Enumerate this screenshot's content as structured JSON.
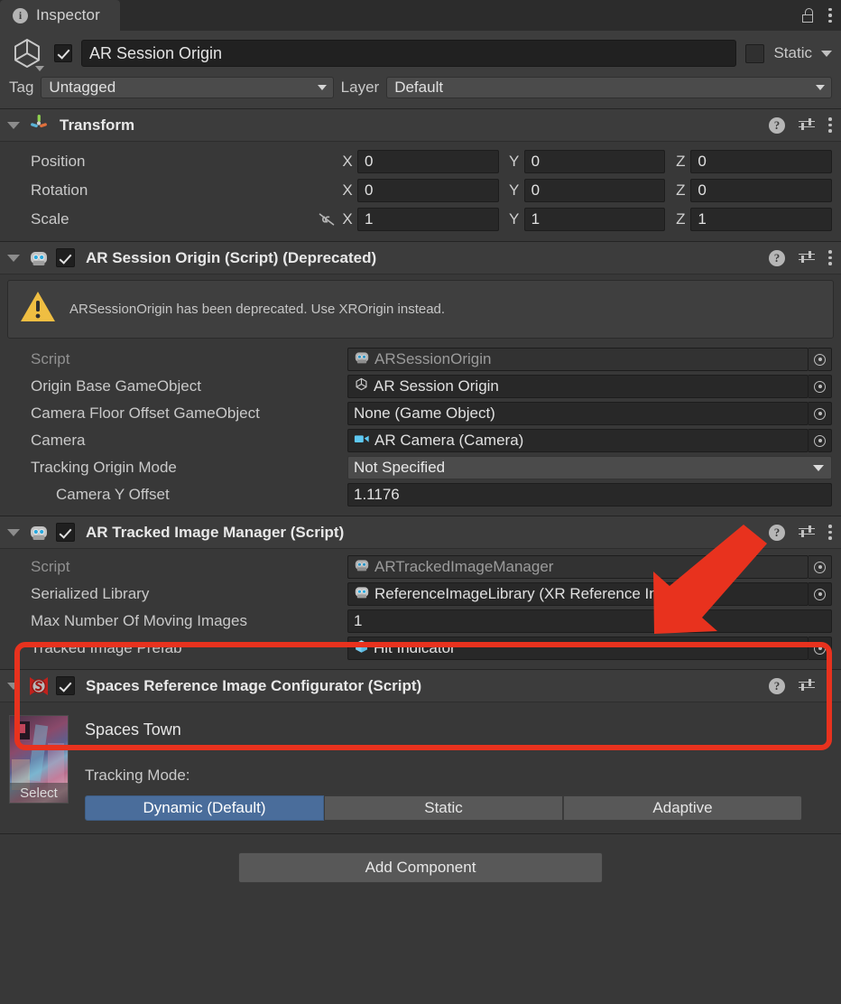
{
  "window": {
    "tab_label": "Inspector",
    "info_icon": "info-icon",
    "lock_icon": "unlocked-padlock-icon",
    "menu_icon": "kebab-menu-icon"
  },
  "gameobject": {
    "icon": "gameobject-cube-icon",
    "enabled": true,
    "name": "AR Session Origin",
    "static_label": "Static",
    "static_checked": false,
    "tag_label": "Tag",
    "tag_value": "Untagged",
    "layer_label": "Layer",
    "layer_value": "Default"
  },
  "components": [
    {
      "id": "transform",
      "icon": "transform-axis-icon",
      "title": "Transform",
      "has_checkbox": false,
      "rows": [
        {
          "label": "Position",
          "x": "0",
          "y": "0",
          "z": "0",
          "link": false
        },
        {
          "label": "Rotation",
          "x": "0",
          "y": "0",
          "z": "0",
          "link": false
        },
        {
          "label": "Scale",
          "x": "1",
          "y": "1",
          "z": "1",
          "link": true
        }
      ],
      "axis_labels": {
        "x": "X",
        "y": "Y",
        "z": "Z"
      }
    },
    {
      "id": "ar-session-origin",
      "icon": "script-robot-icon",
      "title": "AR Session Origin (Script) (Deprecated)",
      "enabled": true,
      "warning": "ARSessionOrigin has been deprecated. Use XROrigin instead.",
      "warning_icon": "warning-triangle-icon",
      "fields": [
        {
          "label": "Script",
          "value": "ARSessionOrigin",
          "icon": "script-robot-icon",
          "kind": "object",
          "disabled": true
        },
        {
          "label": "Origin Base GameObject",
          "value": "AR Session Origin",
          "icon": "gameobject-cube-icon",
          "kind": "object",
          "disabled": false
        },
        {
          "label": "Camera Floor Offset GameObject",
          "value": "None (Game Object)",
          "icon": "",
          "kind": "object",
          "disabled": false
        },
        {
          "label": "Camera",
          "value": "AR Camera (Camera)",
          "icon": "camera-icon",
          "kind": "object",
          "disabled": false
        },
        {
          "label": "Tracking Origin Mode",
          "value": "Not Specified",
          "icon": "",
          "kind": "dropdown",
          "disabled": false
        },
        {
          "label": "Camera Y Offset",
          "value": "1.1176",
          "icon": "",
          "kind": "text",
          "disabled": false,
          "indent": true
        }
      ]
    },
    {
      "id": "ar-tracked-image-manager",
      "icon": "script-robot-icon",
      "title": "AR Tracked Image Manager (Script)",
      "enabled": true,
      "fields": [
        {
          "label": "Script",
          "value": "ARTrackedImageManager",
          "icon": "script-robot-icon",
          "kind": "object",
          "disabled": true
        },
        {
          "label": "Serialized Library",
          "value": "ReferenceImageLibrary (XR Reference Image Lib",
          "icon": "script-robot-icon",
          "kind": "object",
          "disabled": false
        },
        {
          "label": "Max Number Of Moving Images",
          "value": "1",
          "icon": "",
          "kind": "text",
          "disabled": false
        },
        {
          "label": "Tracked Image Prefab",
          "value": "Hit Indicator",
          "icon": "prefab-cube-icon",
          "kind": "object",
          "disabled": false
        }
      ]
    },
    {
      "id": "spaces-reference-image-configurator",
      "icon": "spaces-s-logo-icon",
      "title": "Spaces Reference Image Configurator (Script)",
      "enabled": true,
      "image_name": "Spaces Town",
      "thumbnail_select_label": "Select",
      "tracking_mode_label": "Tracking Mode:",
      "tracking_modes": [
        "Dynamic (Default)",
        "Static",
        "Adaptive"
      ],
      "tracking_mode_selected": 0
    }
  ],
  "footer": {
    "add_component_label": "Add Component"
  },
  "annotations": {
    "highlight_color": "#E8321E",
    "arrow_color": "#E8321E",
    "highlight_target": "ar-tracked-image-manager-fields",
    "arrow_points_to": "serialized-library-row"
  },
  "colors": {
    "panel_bg": "#383838",
    "header_bg": "#3C3C3C",
    "field_bg": "#282828",
    "dropdown_bg": "#4B4B4B",
    "accent_blue": "#4A6D9B",
    "warning_yellow": "#EFBE42",
    "annotation_red": "#E8321E"
  }
}
